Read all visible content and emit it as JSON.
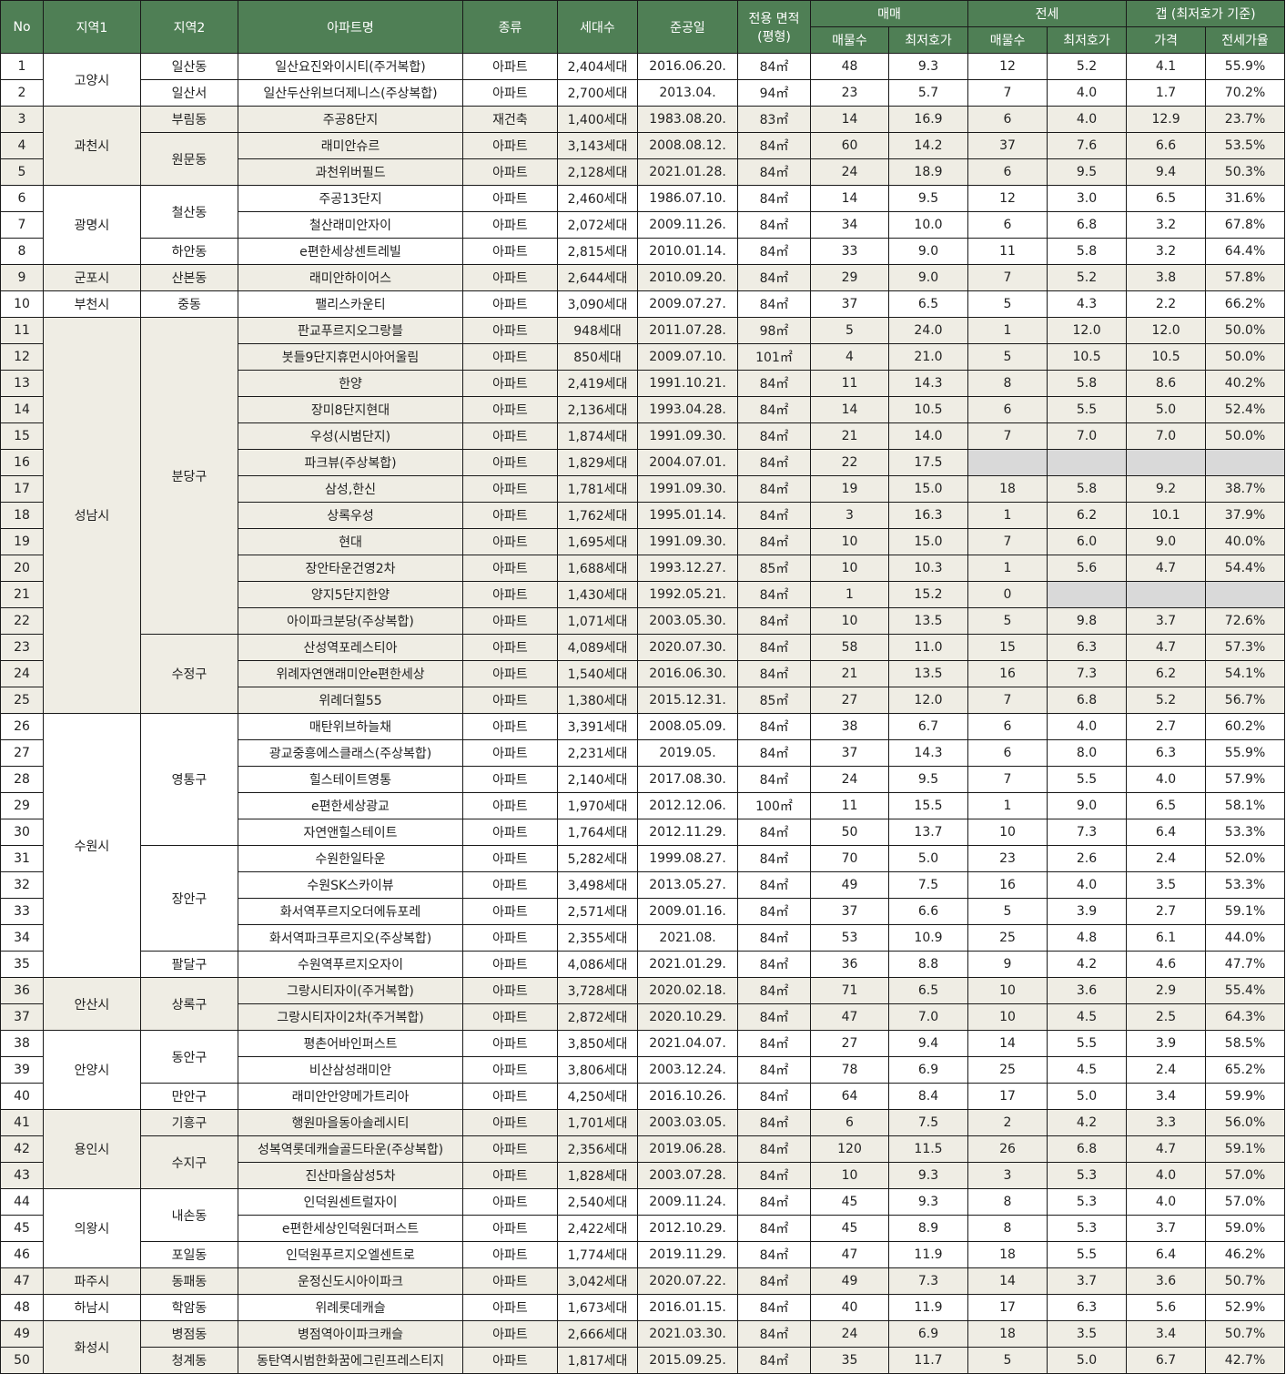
{
  "header": {
    "no": "No",
    "region1": "지역1",
    "region2": "지역2",
    "apt_name": "아파트명",
    "type": "종류",
    "households": "세대수",
    "completed": "준공일",
    "area": "전용 면적",
    "area_unit": "(평형)",
    "sale": "매매",
    "jeonse": "전세",
    "gap": "갭 (최저호가 기준)",
    "listings": "매물수",
    "lowest": "최저호가",
    "gap_price": "가격",
    "jeonse_ratio": "전세가율"
  },
  "rows": [
    {
      "no": "1",
      "apt": "일산요진와이시티(주거복합)",
      "type": "아파트",
      "hh": "2,404세대",
      "date": "2016.06.20.",
      "area": "84㎡",
      "s_cnt": "48",
      "s_low": "9.3",
      "j_cnt": "12",
      "j_low": "5.2",
      "gap": "4.1",
      "ratio": "55.9%"
    },
    {
      "no": "2",
      "apt": "일산두산위브더제니스(주상복합)",
      "type": "아파트",
      "hh": "2,700세대",
      "date": "2013.04.",
      "area": "94㎡",
      "s_cnt": "23",
      "s_low": "5.7",
      "j_cnt": "7",
      "j_low": "4.0",
      "gap": "1.7",
      "ratio": "70.2%"
    },
    {
      "no": "3",
      "apt": "주공8단지",
      "type": "재건축",
      "hh": "1,400세대",
      "date": "1983.08.20.",
      "area": "83㎡",
      "s_cnt": "14",
      "s_low": "16.9",
      "j_cnt": "6",
      "j_low": "4.0",
      "gap": "12.9",
      "ratio": "23.7%"
    },
    {
      "no": "4",
      "apt": "래미안슈르",
      "type": "아파트",
      "hh": "3,143세대",
      "date": "2008.08.12.",
      "area": "84㎡",
      "s_cnt": "60",
      "s_low": "14.2",
      "j_cnt": "37",
      "j_low": "7.6",
      "gap": "6.6",
      "ratio": "53.5%"
    },
    {
      "no": "5",
      "apt": "과천위버필드",
      "type": "아파트",
      "hh": "2,128세대",
      "date": "2021.01.28.",
      "area": "84㎡",
      "s_cnt": "24",
      "s_low": "18.9",
      "j_cnt": "6",
      "j_low": "9.5",
      "gap": "9.4",
      "ratio": "50.3%"
    },
    {
      "no": "6",
      "apt": "주공13단지",
      "type": "아파트",
      "hh": "2,460세대",
      "date": "1986.07.10.",
      "area": "84㎡",
      "s_cnt": "14",
      "s_low": "9.5",
      "j_cnt": "12",
      "j_low": "3.0",
      "gap": "6.5",
      "ratio": "31.6%"
    },
    {
      "no": "7",
      "apt": "철산래미안자이",
      "type": "아파트",
      "hh": "2,072세대",
      "date": "2009.11.26.",
      "area": "84㎡",
      "s_cnt": "34",
      "s_low": "10.0",
      "j_cnt": "6",
      "j_low": "6.8",
      "gap": "3.2",
      "ratio": "67.8%"
    },
    {
      "no": "8",
      "apt": "e편한세상센트레빌",
      "type": "아파트",
      "hh": "2,815세대",
      "date": "2010.01.14.",
      "area": "84㎡",
      "s_cnt": "33",
      "s_low": "9.0",
      "j_cnt": "11",
      "j_low": "5.8",
      "gap": "3.2",
      "ratio": "64.4%"
    },
    {
      "no": "9",
      "apt": "래미안하이어스",
      "type": "아파트",
      "hh": "2,644세대",
      "date": "2010.09.20.",
      "area": "84㎡",
      "s_cnt": "29",
      "s_low": "9.0",
      "j_cnt": "7",
      "j_low": "5.2",
      "gap": "3.8",
      "ratio": "57.8%"
    },
    {
      "no": "10",
      "apt": "팰리스카운티",
      "type": "아파트",
      "hh": "3,090세대",
      "date": "2009.07.27.",
      "area": "84㎡",
      "s_cnt": "37",
      "s_low": "6.5",
      "j_cnt": "5",
      "j_low": "4.3",
      "gap": "2.2",
      "ratio": "66.2%"
    },
    {
      "no": "11",
      "apt": "판교푸르지오그랑블",
      "type": "아파트",
      "hh": "948세대",
      "date": "2011.07.28.",
      "area": "98㎡",
      "s_cnt": "5",
      "s_low": "24.0",
      "j_cnt": "1",
      "j_low": "12.0",
      "gap": "12.0",
      "ratio": "50.0%"
    },
    {
      "no": "12",
      "apt": "봇들9단지휴먼시아어울림",
      "type": "아파트",
      "hh": "850세대",
      "date": "2009.07.10.",
      "area": "101㎡",
      "s_cnt": "4",
      "s_low": "21.0",
      "j_cnt": "5",
      "j_low": "10.5",
      "gap": "10.5",
      "ratio": "50.0%"
    },
    {
      "no": "13",
      "apt": "한양",
      "type": "아파트",
      "hh": "2,419세대",
      "date": "1991.10.21.",
      "area": "84㎡",
      "s_cnt": "11",
      "s_low": "14.3",
      "j_cnt": "8",
      "j_low": "5.8",
      "gap": "8.6",
      "ratio": "40.2%"
    },
    {
      "no": "14",
      "apt": "장미8단지현대",
      "type": "아파트",
      "hh": "2,136세대",
      "date": "1993.04.28.",
      "area": "84㎡",
      "s_cnt": "14",
      "s_low": "10.5",
      "j_cnt": "6",
      "j_low": "5.5",
      "gap": "5.0",
      "ratio": "52.4%"
    },
    {
      "no": "15",
      "apt": "우성(시범단지)",
      "type": "아파트",
      "hh": "1,874세대",
      "date": "1991.09.30.",
      "area": "84㎡",
      "s_cnt": "21",
      "s_low": "14.0",
      "j_cnt": "7",
      "j_low": "7.0",
      "gap": "7.0",
      "ratio": "50.0%"
    },
    {
      "no": "16",
      "apt": "파크뷰(주상복합)",
      "type": "아파트",
      "hh": "1,829세대",
      "date": "2004.07.01.",
      "area": "84㎡",
      "s_cnt": "22",
      "s_low": "17.5",
      "j_cnt": "",
      "j_low": "",
      "gap": "",
      "ratio": ""
    },
    {
      "no": "17",
      "apt": "삼성,한신",
      "type": "아파트",
      "hh": "1,781세대",
      "date": "1991.09.30.",
      "area": "84㎡",
      "s_cnt": "19",
      "s_low": "15.0",
      "j_cnt": "18",
      "j_low": "5.8",
      "gap": "9.2",
      "ratio": "38.7%"
    },
    {
      "no": "18",
      "apt": "상록우성",
      "type": "아파트",
      "hh": "1,762세대",
      "date": "1995.01.14.",
      "area": "84㎡",
      "s_cnt": "3",
      "s_low": "16.3",
      "j_cnt": "1",
      "j_low": "6.2",
      "gap": "10.1",
      "ratio": "37.9%"
    },
    {
      "no": "19",
      "apt": "현대",
      "type": "아파트",
      "hh": "1,695세대",
      "date": "1991.09.30.",
      "area": "84㎡",
      "s_cnt": "10",
      "s_low": "15.0",
      "j_cnt": "7",
      "j_low": "6.0",
      "gap": "9.0",
      "ratio": "40.0%"
    },
    {
      "no": "20",
      "apt": "장안타운건영2차",
      "type": "아파트",
      "hh": "1,688세대",
      "date": "1993.12.27.",
      "area": "85㎡",
      "s_cnt": "10",
      "s_low": "10.3",
      "j_cnt": "1",
      "j_low": "5.6",
      "gap": "4.7",
      "ratio": "54.4%"
    },
    {
      "no": "21",
      "apt": "양지5단지한양",
      "type": "아파트",
      "hh": "1,430세대",
      "date": "1992.05.21.",
      "area": "84㎡",
      "s_cnt": "1",
      "s_low": "15.2",
      "j_cnt": "0",
      "j_low": "",
      "gap": "",
      "ratio": ""
    },
    {
      "no": "22",
      "apt": "아이파크분당(주상복합)",
      "type": "아파트",
      "hh": "1,071세대",
      "date": "2003.05.30.",
      "area": "84㎡",
      "s_cnt": "10",
      "s_low": "13.5",
      "j_cnt": "5",
      "j_low": "9.8",
      "gap": "3.7",
      "ratio": "72.6%"
    },
    {
      "no": "23",
      "apt": "산성역포레스티아",
      "type": "아파트",
      "hh": "4,089세대",
      "date": "2020.07.30.",
      "area": "84㎡",
      "s_cnt": "58",
      "s_low": "11.0",
      "j_cnt": "15",
      "j_low": "6.3",
      "gap": "4.7",
      "ratio": "57.3%"
    },
    {
      "no": "24",
      "apt": "위례자연앤래미안e편한세상",
      "type": "아파트",
      "hh": "1,540세대",
      "date": "2016.06.30.",
      "area": "84㎡",
      "s_cnt": "21",
      "s_low": "13.5",
      "j_cnt": "16",
      "j_low": "7.3",
      "gap": "6.2",
      "ratio": "54.1%"
    },
    {
      "no": "25",
      "apt": "위례더힐55",
      "type": "아파트",
      "hh": "1,380세대",
      "date": "2015.12.31.",
      "area": "85㎡",
      "s_cnt": "27",
      "s_low": "12.0",
      "j_cnt": "7",
      "j_low": "6.8",
      "gap": "5.2",
      "ratio": "56.7%"
    },
    {
      "no": "26",
      "apt": "매탄위브하늘채",
      "type": "아파트",
      "hh": "3,391세대",
      "date": "2008.05.09.",
      "area": "84㎡",
      "s_cnt": "38",
      "s_low": "6.7",
      "j_cnt": "6",
      "j_low": "4.0",
      "gap": "2.7",
      "ratio": "60.2%"
    },
    {
      "no": "27",
      "apt": "광교중흥에스클래스(주상복합)",
      "type": "아파트",
      "hh": "2,231세대",
      "date": "2019.05.",
      "area": "84㎡",
      "s_cnt": "37",
      "s_low": "14.3",
      "j_cnt": "6",
      "j_low": "8.0",
      "gap": "6.3",
      "ratio": "55.9%"
    },
    {
      "no": "28",
      "apt": "힐스테이트영통",
      "type": "아파트",
      "hh": "2,140세대",
      "date": "2017.08.30.",
      "area": "84㎡",
      "s_cnt": "24",
      "s_low": "9.5",
      "j_cnt": "7",
      "j_low": "5.5",
      "gap": "4.0",
      "ratio": "57.9%"
    },
    {
      "no": "29",
      "apt": "e편한세상광교",
      "type": "아파트",
      "hh": "1,970세대",
      "date": "2012.12.06.",
      "area": "100㎡",
      "s_cnt": "11",
      "s_low": "15.5",
      "j_cnt": "1",
      "j_low": "9.0",
      "gap": "6.5",
      "ratio": "58.1%"
    },
    {
      "no": "30",
      "apt": "자연앤힐스테이트",
      "type": "아파트",
      "hh": "1,764세대",
      "date": "2012.11.29.",
      "area": "84㎡",
      "s_cnt": "50",
      "s_low": "13.7",
      "j_cnt": "10",
      "j_low": "7.3",
      "gap": "6.4",
      "ratio": "53.3%"
    },
    {
      "no": "31",
      "apt": "수원한일타운",
      "type": "아파트",
      "hh": "5,282세대",
      "date": "1999.08.27.",
      "area": "84㎡",
      "s_cnt": "70",
      "s_low": "5.0",
      "j_cnt": "23",
      "j_low": "2.6",
      "gap": "2.4",
      "ratio": "52.0%"
    },
    {
      "no": "32",
      "apt": "수원SK스카이뷰",
      "type": "아파트",
      "hh": "3,498세대",
      "date": "2013.05.27.",
      "area": "84㎡",
      "s_cnt": "49",
      "s_low": "7.5",
      "j_cnt": "16",
      "j_low": "4.0",
      "gap": "3.5",
      "ratio": "53.3%"
    },
    {
      "no": "33",
      "apt": "화서역푸르지오더에듀포레",
      "type": "아파트",
      "hh": "2,571세대",
      "date": "2009.01.16.",
      "area": "84㎡",
      "s_cnt": "37",
      "s_low": "6.6",
      "j_cnt": "5",
      "j_low": "3.9",
      "gap": "2.7",
      "ratio": "59.1%"
    },
    {
      "no": "34",
      "apt": "화서역파크푸르지오(주상복합)",
      "type": "아파트",
      "hh": "2,355세대",
      "date": "2021.08.",
      "area": "84㎡",
      "s_cnt": "53",
      "s_low": "10.9",
      "j_cnt": "25",
      "j_low": "4.8",
      "gap": "6.1",
      "ratio": "44.0%"
    },
    {
      "no": "35",
      "apt": "수원역푸르지오자이",
      "type": "아파트",
      "hh": "4,086세대",
      "date": "2021.01.29.",
      "area": "84㎡",
      "s_cnt": "36",
      "s_low": "8.8",
      "j_cnt": "9",
      "j_low": "4.2",
      "gap": "4.6",
      "ratio": "47.7%"
    },
    {
      "no": "36",
      "apt": "그랑시티자이(주거복합)",
      "type": "아파트",
      "hh": "3,728세대",
      "date": "2020.02.18.",
      "area": "84㎡",
      "s_cnt": "71",
      "s_low": "6.5",
      "j_cnt": "10",
      "j_low": "3.6",
      "gap": "2.9",
      "ratio": "55.4%"
    },
    {
      "no": "37",
      "apt": "그랑시티자이2차(주거복합)",
      "type": "아파트",
      "hh": "2,872세대",
      "date": "2020.10.29.",
      "area": "84㎡",
      "s_cnt": "47",
      "s_low": "7.0",
      "j_cnt": "10",
      "j_low": "4.5",
      "gap": "2.5",
      "ratio": "64.3%"
    },
    {
      "no": "38",
      "apt": "평촌어바인퍼스트",
      "type": "아파트",
      "hh": "3,850세대",
      "date": "2021.04.07.",
      "area": "84㎡",
      "s_cnt": "27",
      "s_low": "9.4",
      "j_cnt": "14",
      "j_low": "5.5",
      "gap": "3.9",
      "ratio": "58.5%"
    },
    {
      "no": "39",
      "apt": "비산삼성래미안",
      "type": "아파트",
      "hh": "3,806세대",
      "date": "2003.12.24.",
      "area": "84㎡",
      "s_cnt": "78",
      "s_low": "6.9",
      "j_cnt": "25",
      "j_low": "4.5",
      "gap": "2.4",
      "ratio": "65.2%"
    },
    {
      "no": "40",
      "apt": "래미안안양메가트리아",
      "type": "아파트",
      "hh": "4,250세대",
      "date": "2016.10.26.",
      "area": "84㎡",
      "s_cnt": "64",
      "s_low": "8.4",
      "j_cnt": "17",
      "j_low": "5.0",
      "gap": "3.4",
      "ratio": "59.9%"
    },
    {
      "no": "41",
      "apt": "행원마을동아솔레시티",
      "type": "아파트",
      "hh": "1,701세대",
      "date": "2003.03.05.",
      "area": "84㎡",
      "s_cnt": "6",
      "s_low": "7.5",
      "j_cnt": "2",
      "j_low": "4.2",
      "gap": "3.3",
      "ratio": "56.0%"
    },
    {
      "no": "42",
      "apt": "성복역롯데캐슬골드타운(주상복합)",
      "type": "아파트",
      "hh": "2,356세대",
      "date": "2019.06.28.",
      "area": "84㎡",
      "s_cnt": "120",
      "s_low": "11.5",
      "j_cnt": "26",
      "j_low": "6.8",
      "gap": "4.7",
      "ratio": "59.1%"
    },
    {
      "no": "43",
      "apt": "진산마을삼성5차",
      "type": "아파트",
      "hh": "1,828세대",
      "date": "2003.07.28.",
      "area": "84㎡",
      "s_cnt": "10",
      "s_low": "9.3",
      "j_cnt": "3",
      "j_low": "5.3",
      "gap": "4.0",
      "ratio": "57.0%"
    },
    {
      "no": "44",
      "apt": "인덕원센트럴자이",
      "type": "아파트",
      "hh": "2,540세대",
      "date": "2009.11.24.",
      "area": "84㎡",
      "s_cnt": "45",
      "s_low": "9.3",
      "j_cnt": "8",
      "j_low": "5.3",
      "gap": "4.0",
      "ratio": "57.0%"
    },
    {
      "no": "45",
      "apt": "e편한세상인덕원더퍼스트",
      "type": "아파트",
      "hh": "2,422세대",
      "date": "2012.10.29.",
      "area": "84㎡",
      "s_cnt": "45",
      "s_low": "8.9",
      "j_cnt": "8",
      "j_low": "5.3",
      "gap": "3.7",
      "ratio": "59.0%"
    },
    {
      "no": "46",
      "apt": "인덕원푸르지오엘센트로",
      "type": "아파트",
      "hh": "1,774세대",
      "date": "2019.11.29.",
      "area": "84㎡",
      "s_cnt": "47",
      "s_low": "11.9",
      "j_cnt": "18",
      "j_low": "5.5",
      "gap": "6.4",
      "ratio": "46.2%"
    },
    {
      "no": "47",
      "apt": "운정신도시아이파크",
      "type": "아파트",
      "hh": "3,042세대",
      "date": "2020.07.22.",
      "area": "84㎡",
      "s_cnt": "49",
      "s_low": "7.3",
      "j_cnt": "14",
      "j_low": "3.7",
      "gap": "3.6",
      "ratio": "50.7%"
    },
    {
      "no": "48",
      "apt": "위례롯데캐슬",
      "type": "아파트",
      "hh": "1,673세대",
      "date": "2016.01.15.",
      "area": "84㎡",
      "s_cnt": "40",
      "s_low": "11.9",
      "j_cnt": "17",
      "j_low": "6.3",
      "gap": "5.6",
      "ratio": "52.9%"
    },
    {
      "no": "49",
      "apt": "병점역아이파크캐슬",
      "type": "아파트",
      "hh": "2,666세대",
      "date": "2021.03.30.",
      "area": "84㎡",
      "s_cnt": "24",
      "s_low": "6.9",
      "j_cnt": "18",
      "j_low": "3.5",
      "gap": "3.4",
      "ratio": "50.7%"
    },
    {
      "no": "50",
      "apt": "동탄역시범한화꿈에그린프레스티지",
      "type": "아파트",
      "hh": "1,817세대",
      "date": "2015.09.25.",
      "area": "84㎡",
      "s_cnt": "35",
      "s_low": "11.7",
      "j_cnt": "5",
      "j_low": "5.0",
      "gap": "6.7",
      "ratio": "42.7%"
    }
  ],
  "region1": [
    {
      "label": "고양시",
      "start": 1,
      "span": 2,
      "shade": false
    },
    {
      "label": "과천시",
      "start": 3,
      "span": 3,
      "shade": true
    },
    {
      "label": "광명시",
      "start": 6,
      "span": 3,
      "shade": false
    },
    {
      "label": "군포시",
      "start": 9,
      "span": 1,
      "shade": true
    },
    {
      "label": "부천시",
      "start": 10,
      "span": 1,
      "shade": false
    },
    {
      "label": "성남시",
      "start": 11,
      "span": 15,
      "shade": true
    },
    {
      "label": "수원시",
      "start": 26,
      "span": 10,
      "shade": false
    },
    {
      "label": "안산시",
      "start": 36,
      "span": 2,
      "shade": true
    },
    {
      "label": "안양시",
      "start": 38,
      "span": 3,
      "shade": false
    },
    {
      "label": "용인시",
      "start": 41,
      "span": 3,
      "shade": true
    },
    {
      "label": "의왕시",
      "start": 44,
      "span": 3,
      "shade": false
    },
    {
      "label": "파주시",
      "start": 47,
      "span": 1,
      "shade": true
    },
    {
      "label": "하남시",
      "start": 48,
      "span": 1,
      "shade": false
    },
    {
      "label": "화성시",
      "start": 49,
      "span": 2,
      "shade": true
    }
  ],
  "region2": [
    {
      "label": "일산동",
      "start": 1,
      "span": 1
    },
    {
      "label": "일산서",
      "start": 2,
      "span": 1
    },
    {
      "label": "부림동",
      "start": 3,
      "span": 1
    },
    {
      "label": "원문동",
      "start": 4,
      "span": 2
    },
    {
      "label": "철산동",
      "start": 6,
      "span": 2
    },
    {
      "label": "하안동",
      "start": 8,
      "span": 1
    },
    {
      "label": "산본동",
      "start": 9,
      "span": 1
    },
    {
      "label": "중동",
      "start": 10,
      "span": 1
    },
    {
      "label": "분당구",
      "start": 11,
      "span": 12
    },
    {
      "label": "수정구",
      "start": 23,
      "span": 3
    },
    {
      "label": "영통구",
      "start": 26,
      "span": 5
    },
    {
      "label": "장안구",
      "start": 31,
      "span": 4
    },
    {
      "label": "팔달구",
      "start": 35,
      "span": 1
    },
    {
      "label": "상록구",
      "start": 36,
      "span": 2
    },
    {
      "label": "동안구",
      "start": 38,
      "span": 2
    },
    {
      "label": "만안구",
      "start": 40,
      "span": 1
    },
    {
      "label": "기흥구",
      "start": 41,
      "span": 1
    },
    {
      "label": "수지구",
      "start": 42,
      "span": 2
    },
    {
      "label": "내손동",
      "start": 44,
      "span": 2
    },
    {
      "label": "포일동",
      "start": 46,
      "span": 1
    },
    {
      "label": "동패동",
      "start": 47,
      "span": 1
    },
    {
      "label": "학암동",
      "start": 48,
      "span": 1
    },
    {
      "label": "병점동",
      "start": 49,
      "span": 1
    },
    {
      "label": "청계동",
      "start": 50,
      "span": 1
    }
  ],
  "blank_cells": {
    "16": [
      "j_cnt",
      "j_low",
      "gap",
      "ratio"
    ],
    "21": [
      "j_low",
      "gap",
      "ratio"
    ]
  },
  "colors": {
    "header_bg": "#4f7f55",
    "header_text": "#ffffff",
    "shade_row": "#efede4",
    "blank_cell": "#d9d9d9"
  }
}
